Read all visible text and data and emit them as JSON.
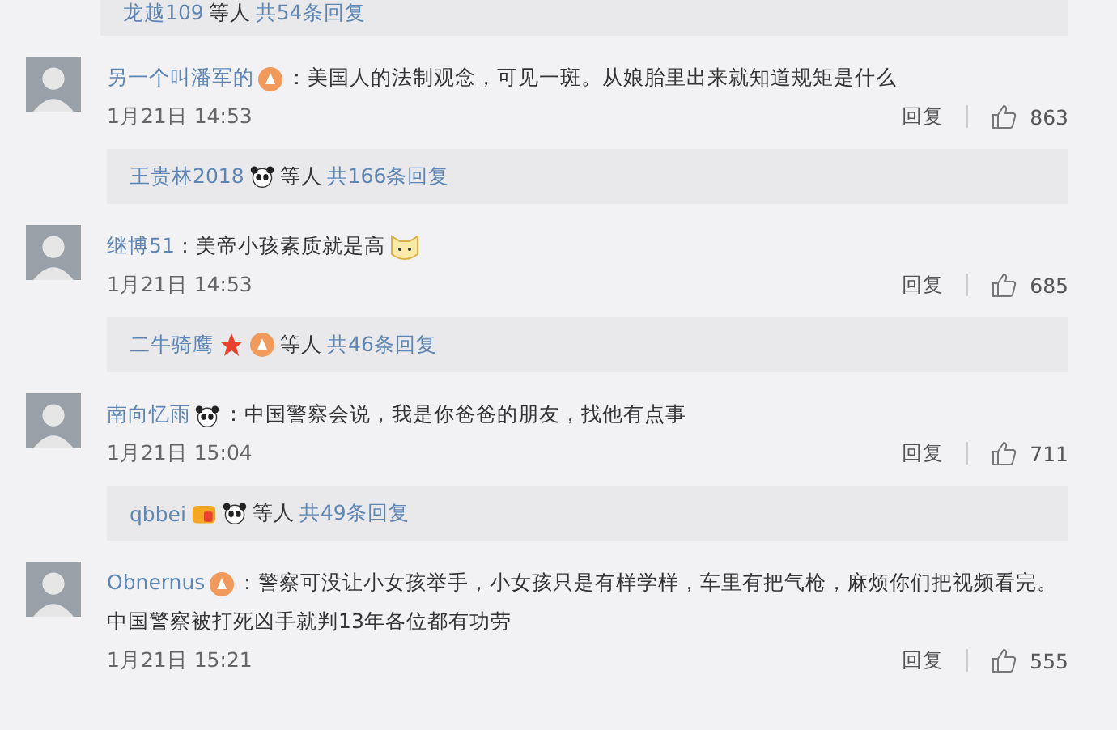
{
  "top_summary": {
    "user": "龙越109",
    "suffix": "等人",
    "count": "共54条回复"
  },
  "comments": [
    {
      "name": "另一个叫潘军的",
      "name_badges": [
        {
          "kind": "vip"
        }
      ],
      "text": "：美国人的法制观念，可见一斑。从娘胎里出来就知道规矩是什么",
      "time": "1月21日 14:53",
      "reply": "回复",
      "likes": "863",
      "summary": {
        "user": "王贵林2018",
        "badges": [
          {
            "kind": "panda"
          }
        ],
        "suffix": "等人",
        "count": "共166条回复"
      }
    },
    {
      "name": "继博51",
      "text": "：美帝小孩素质就是高",
      "text_badges": [
        {
          "kind": "cat"
        }
      ],
      "time": "1月21日 14:53",
      "reply": "回复",
      "likes": "685",
      "summary": {
        "user": "二牛骑鹰",
        "badges": [
          {
            "kind": "star"
          },
          {
            "kind": "vip"
          }
        ],
        "suffix": "等人",
        "count": "共46条回复"
      }
    },
    {
      "name": "南向忆雨",
      "name_badges": [
        {
          "kind": "panda"
        }
      ],
      "text": "：中国警察会说，我是你爸爸的朋友，找他有点事",
      "time": "1月21日 15:04",
      "reply": "回复",
      "likes": "711",
      "summary": {
        "user": "qbbei",
        "badges": [
          {
            "kind": "member"
          },
          {
            "kind": "panda"
          }
        ],
        "suffix": "等人",
        "count": "共49条回复"
      }
    },
    {
      "name": "Obnernus",
      "name_badges": [
        {
          "kind": "vip"
        }
      ],
      "text": "：警察可没让小女孩举手，小女孩只是有样学样，车里有把气枪，麻烦你们把视频看完。中国警察被打死凶手就判13年各位都有功劳",
      "time": "1月21日 15:21",
      "reply": "回复",
      "likes": "555"
    }
  ]
}
